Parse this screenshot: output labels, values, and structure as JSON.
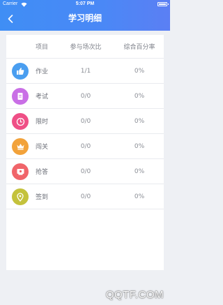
{
  "status_bar": {
    "carrier": "Carrier",
    "time": "5:07 PM",
    "battery_level": 0.95
  },
  "nav": {
    "title": "学习明细",
    "back_icon": "chevron-left-icon"
  },
  "table": {
    "headers": [
      "项目",
      "参与场次比",
      "综合百分率"
    ],
    "rows": [
      {
        "name": "作业",
        "ratio": "1/1",
        "percent": "0%",
        "icon": "thumbs-up-icon",
        "color": "#4a9ef0"
      },
      {
        "name": "考试",
        "ratio": "0/0",
        "percent": "0%",
        "icon": "exam-paper-icon",
        "color": "#c96fe6"
      },
      {
        "name": "限时",
        "ratio": "0/0",
        "percent": "0%",
        "icon": "clock-icon",
        "color": "#ef4f86"
      },
      {
        "name": "闯关",
        "ratio": "0/0",
        "percent": "0%",
        "icon": "crown-icon",
        "color": "#f2a23a"
      },
      {
        "name": "抢答",
        "ratio": "0/0",
        "percent": "0%",
        "icon": "buzzer-icon",
        "color": "#f0656a"
      },
      {
        "name": "签到",
        "ratio": "0/0",
        "percent": "0%",
        "icon": "location-pin-icon",
        "color": "#c4c23c"
      }
    ]
  },
  "watermark": {
    "text": "QQTF.COM"
  }
}
